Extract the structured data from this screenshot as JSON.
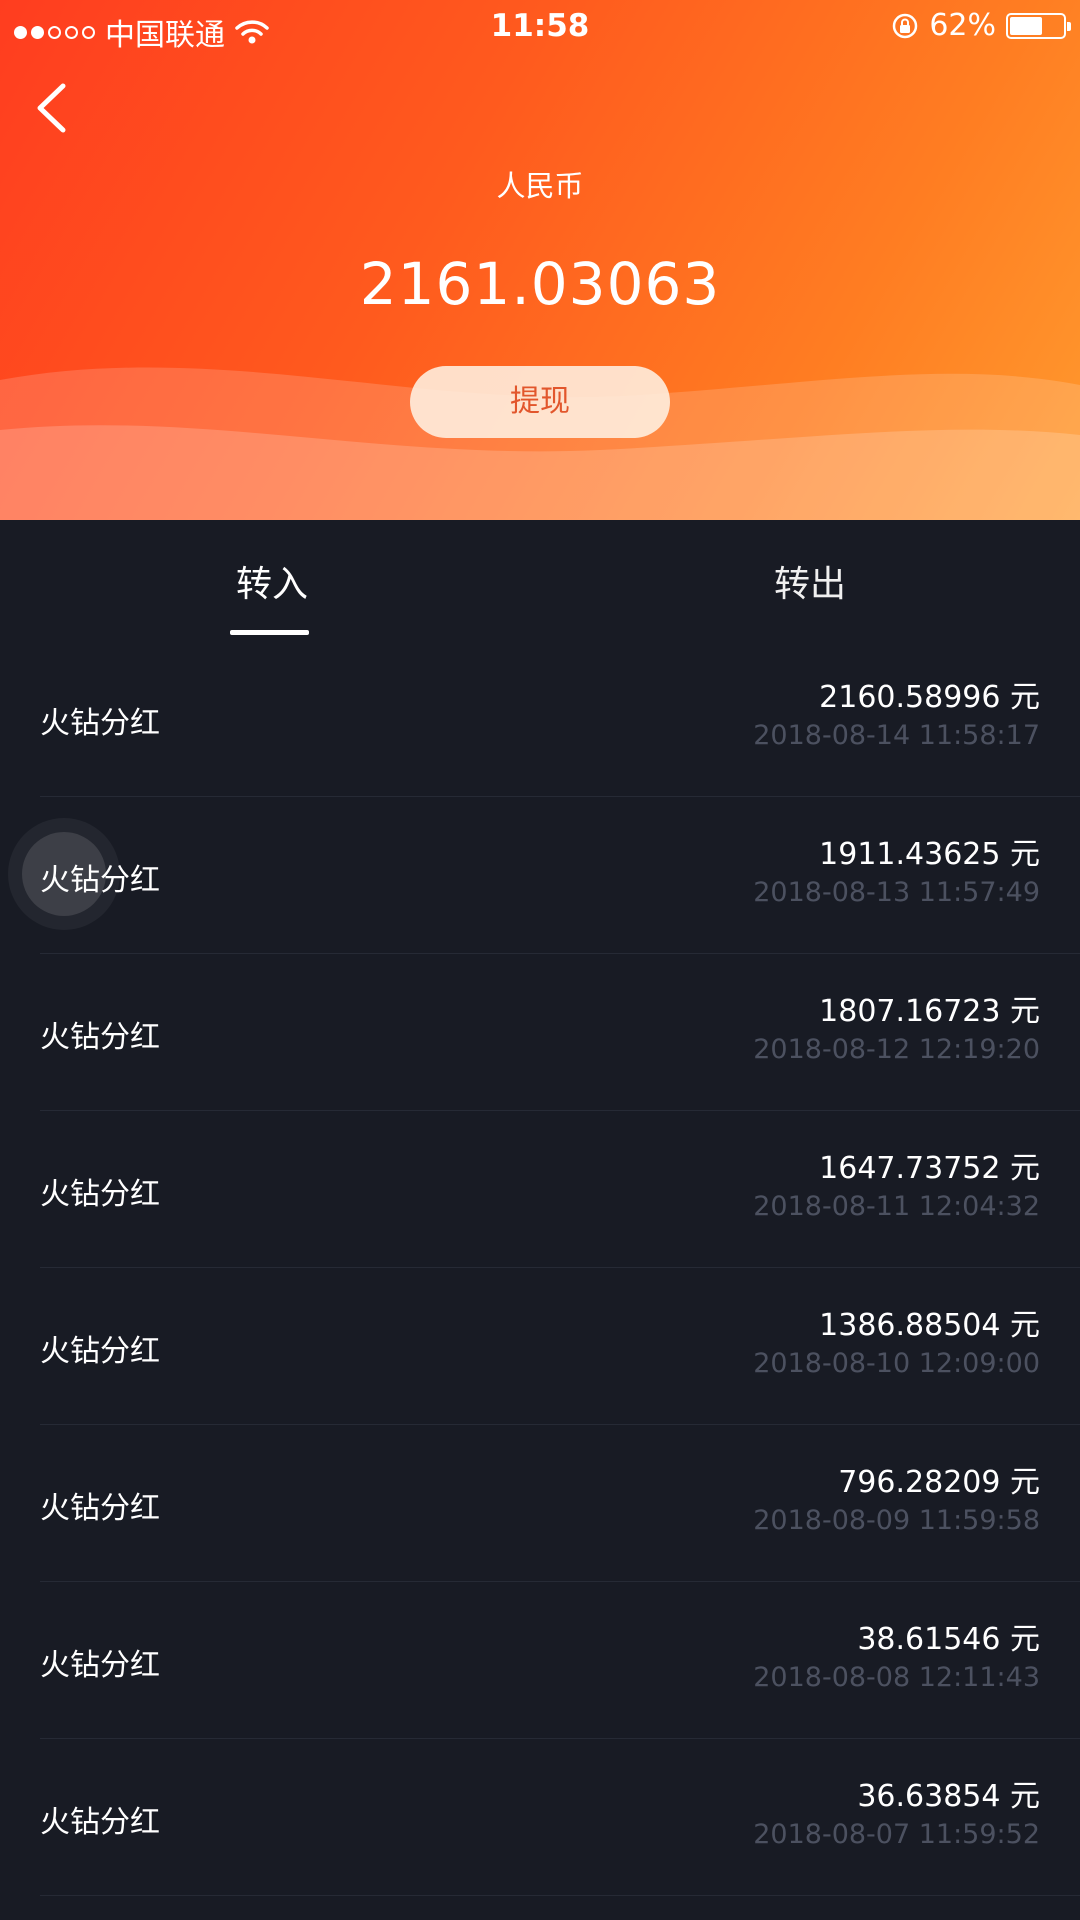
{
  "status_bar": {
    "carrier": "中国联通",
    "time": "11:58",
    "battery_percent": "62%",
    "battery_level": 0.62
  },
  "header": {
    "currency_label": "人民币",
    "balance": "2161.03063",
    "withdraw_label": "提现"
  },
  "tabs": {
    "in_label": "转入",
    "out_label": "转出",
    "active": "in"
  },
  "transactions": [
    {
      "title": "火钻分红",
      "amount": "2160.58996 元",
      "date": "2018-08-14 11:58:17"
    },
    {
      "title": "火钻分红",
      "amount": "1911.43625 元",
      "date": "2018-08-13 11:57:49"
    },
    {
      "title": "火钻分红",
      "amount": "1807.16723 元",
      "date": "2018-08-12 12:19:20"
    },
    {
      "title": "火钻分红",
      "amount": "1647.73752 元",
      "date": "2018-08-11 12:04:32"
    },
    {
      "title": "火钻分红",
      "amount": "1386.88504 元",
      "date": "2018-08-10 12:09:00"
    },
    {
      "title": "火钻分红",
      "amount": "796.28209 元",
      "date": "2018-08-09 11:59:58"
    },
    {
      "title": "火钻分红",
      "amount": "38.61546 元",
      "date": "2018-08-08 12:11:43"
    },
    {
      "title": "火钻分红",
      "amount": "36.63854 元",
      "date": "2018-08-07 11:59:52"
    }
  ],
  "colors": {
    "header_gradient_start": "#ff3d1f",
    "header_gradient_end": "#ff9a2e",
    "background": "#181b24",
    "withdraw_text": "#e2562c"
  }
}
